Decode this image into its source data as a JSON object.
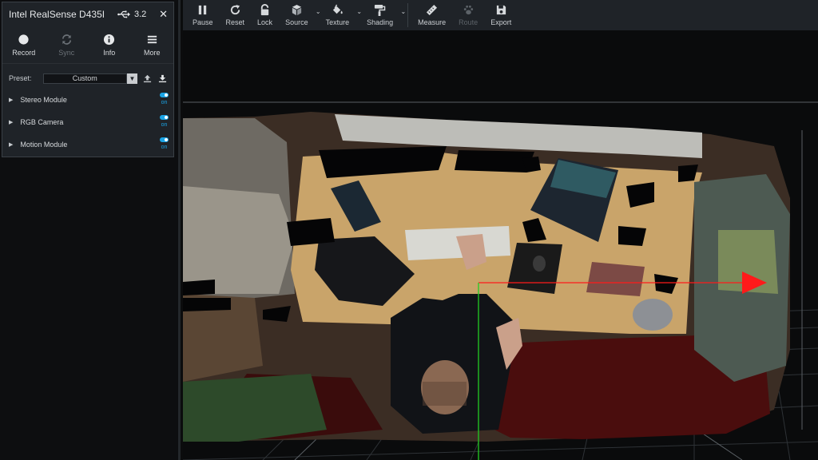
{
  "device_panel": {
    "title": "Intel RealSense D435I",
    "usb_version": "3.2",
    "actions": [
      {
        "label": "Record",
        "icon": "record-icon",
        "enabled": true
      },
      {
        "label": "Sync",
        "icon": "sync-icon",
        "enabled": false
      },
      {
        "label": "Info",
        "icon": "info-icon",
        "enabled": true
      },
      {
        "label": "More",
        "icon": "menu-icon",
        "enabled": true
      }
    ],
    "preset": {
      "label": "Preset:",
      "value": "Custom"
    },
    "modules": [
      {
        "label": "Stereo Module",
        "toggle": "on"
      },
      {
        "label": "RGB Camera",
        "toggle": "on"
      },
      {
        "label": "Motion Module",
        "toggle": "on"
      }
    ]
  },
  "toolbar": {
    "items": [
      {
        "label": "Pause",
        "icon": "pause-icon"
      },
      {
        "label": "Reset",
        "icon": "reset-icon"
      },
      {
        "label": "Lock",
        "icon": "lock-icon"
      },
      {
        "label": "Source",
        "icon": "cube-icon"
      },
      {
        "label": "Texture",
        "icon": "paint-bucket-icon"
      },
      {
        "label": "Shading",
        "icon": "paint-roller-icon"
      },
      {
        "label": "Measure",
        "icon": "ruler-icon"
      },
      {
        "label": "Route",
        "icon": "paw-icon"
      },
      {
        "label": "Export",
        "icon": "save-icon"
      }
    ]
  },
  "colors": {
    "panel_bg": "#1f2328",
    "accent_blue": "#1aa4e6",
    "axis_red": "#ff1a1a",
    "axis_green": "#22cc22",
    "desk": "#c9a46a",
    "floor_red": "#4a0d0d"
  }
}
